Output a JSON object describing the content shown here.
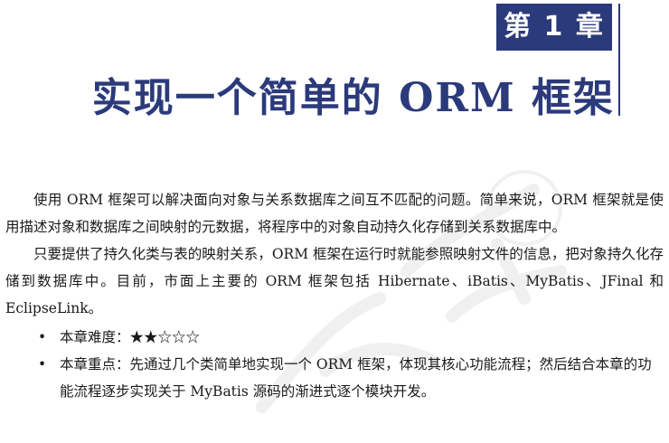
{
  "chapter": {
    "label": "第 1 章",
    "title": "实现一个简单的 ORM 框架"
  },
  "paragraphs": [
    "使用 ORM 框架可以解决面向对象与关系数据库之间互不匹配的问题。简单来说，ORM 框架就是使用描述对象和数据库之间映射的元数据，将程序中的对象自动持久化存储到关系数据库中。",
    "只要提供了持久化类与表的映射关系，ORM 框架在运行时就能参照映射文件的信息，把对象持久化存储到数据库中。目前，市面上主要的 ORM 框架包括 Hibernate、iBatis、MyBatis、JFinal 和 EclipseLink。"
  ],
  "bullets": [
    {
      "marker": "•",
      "text": "本章难度：★★☆☆☆"
    },
    {
      "marker": "•",
      "text": "本章重点：先通过几个类简单地实现一个 ORM 框架，体现其核心功能流程；然后结合本章的功能流程逐步实现关于 MyBatis 源码的渐进式逐个模块开发。"
    }
  ],
  "watermark": {
    "icon": "publisher-watermark-icon",
    "color": "#888888"
  },
  "colors": {
    "accent": "#2b3a7a"
  }
}
